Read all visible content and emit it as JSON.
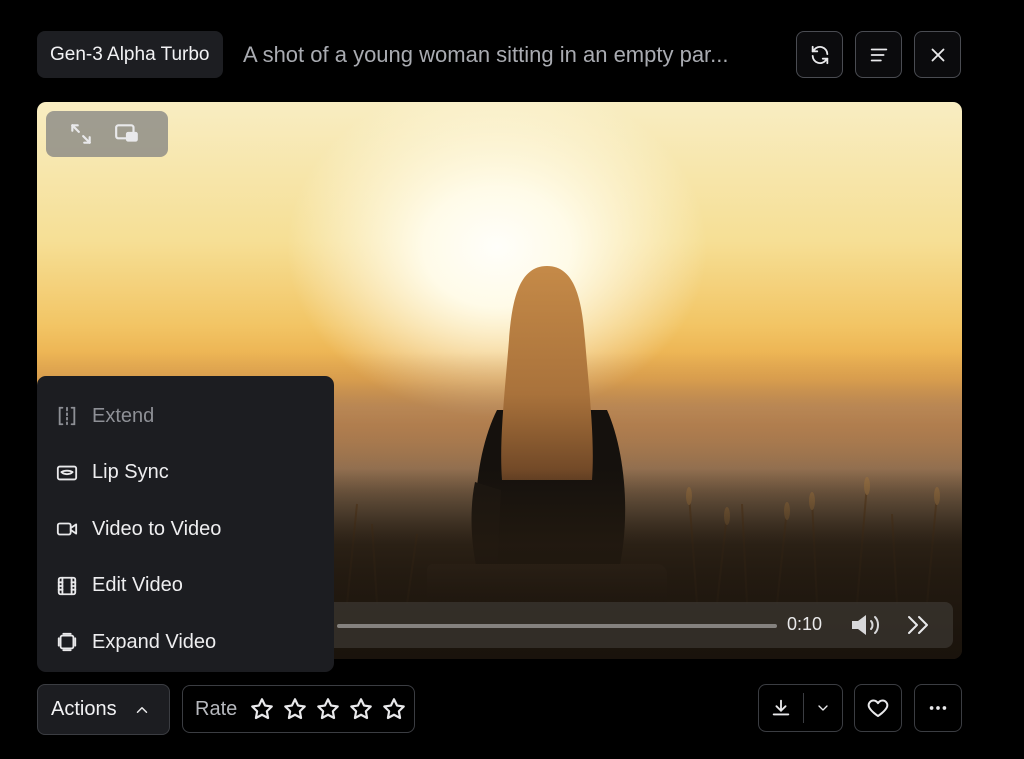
{
  "header": {
    "model": "Gen-3 Alpha Turbo",
    "prompt": "A shot of a young woman sitting in an empty par..."
  },
  "player": {
    "time": "0:10"
  },
  "menu": {
    "items": [
      {
        "label": "Extend",
        "icon": "extend-icon",
        "enabled": false
      },
      {
        "label": "Lip Sync",
        "icon": "lip-sync-icon",
        "enabled": true
      },
      {
        "label": "Video to Video",
        "icon": "video-camera-icon",
        "enabled": true
      },
      {
        "label": "Edit Video",
        "icon": "film-icon",
        "enabled": true
      },
      {
        "label": "Expand Video",
        "icon": "expand-video-icon",
        "enabled": true
      }
    ]
  },
  "footer": {
    "actions_label": "Actions",
    "rate_label": "Rate",
    "rating": 0,
    "rating_max": 5
  }
}
